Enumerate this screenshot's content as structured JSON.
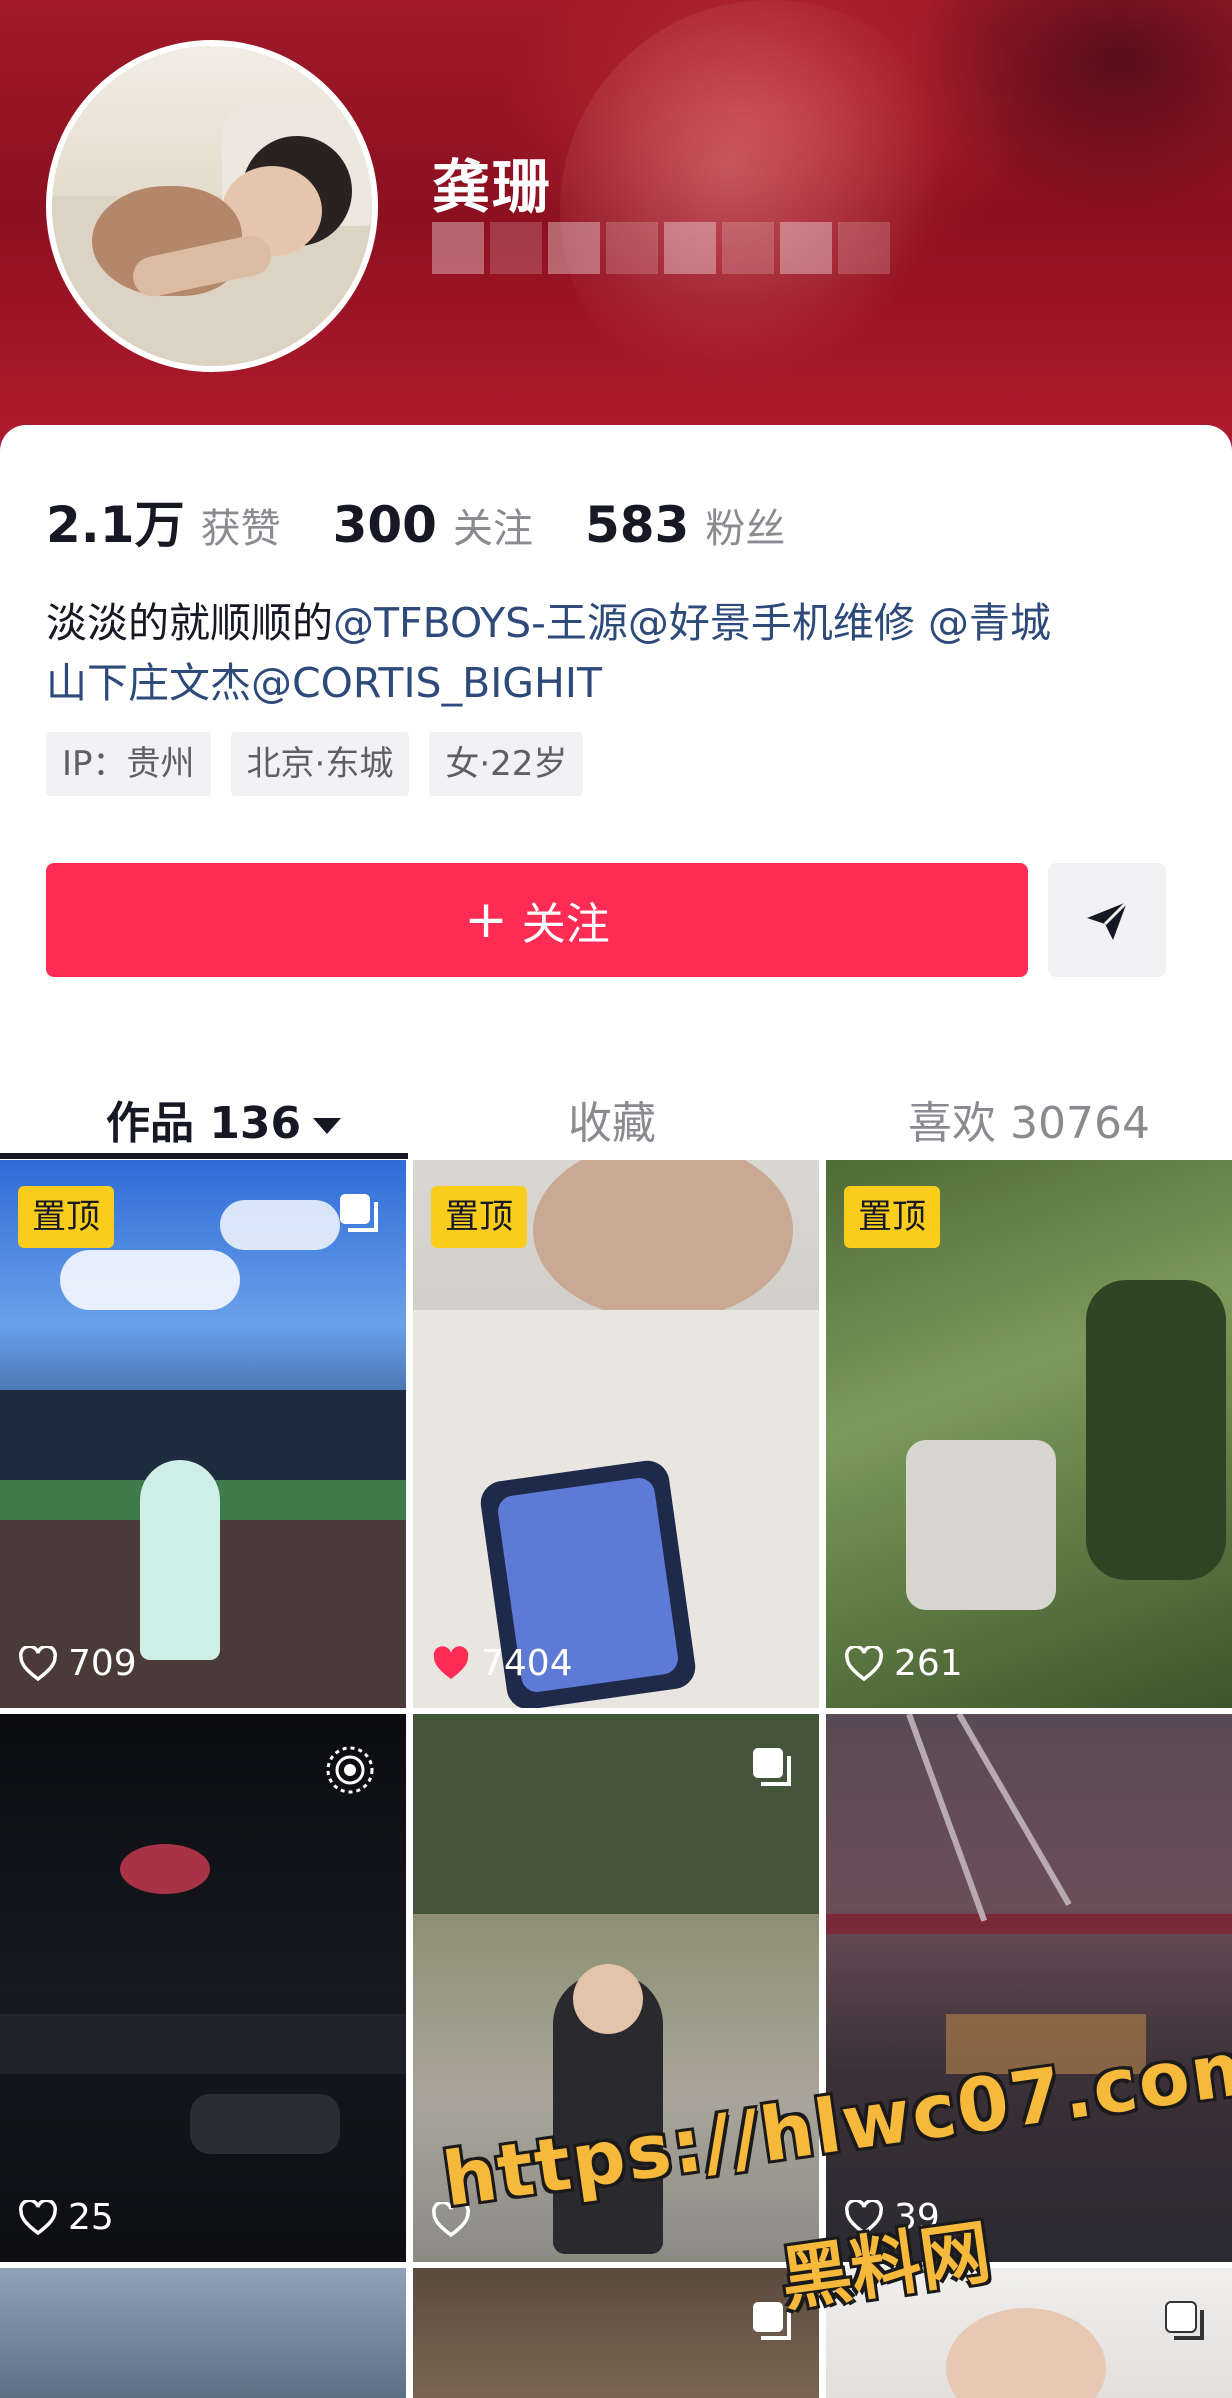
{
  "profile": {
    "nickname": "龚珊",
    "stats": [
      {
        "value": "2.1万",
        "label": "获赞"
      },
      {
        "value": "300",
        "label": "关注"
      },
      {
        "value": "583",
        "label": "粉丝"
      }
    ],
    "bio_plain": "淡淡的就顺顺的",
    "bio_mention_1": "@TFBOYS-王源@好景手机维修 @青城",
    "bio_mention_2": "山下庄文杰@CORTIS_BIGHIT",
    "tags": [
      "IP：贵州",
      "北京·东城",
      "女·22岁"
    ],
    "follow_label": "关注",
    "follow_plus": "+"
  },
  "tabs": [
    {
      "label": "作品 136",
      "active": true
    },
    {
      "label": "收藏",
      "active": false
    },
    {
      "label": "喜欢 30764",
      "active": false
    }
  ],
  "grid": [
    {
      "pinned": true,
      "pin_label": "置顶",
      "likes": "709",
      "multi": true
    },
    {
      "pinned": true,
      "pin_label": "置顶",
      "likes": "7404",
      "liked": true
    },
    {
      "pinned": true,
      "pin_label": "置顶",
      "likes": "261"
    },
    {
      "likes": "25",
      "live": true
    },
    {
      "likes": "",
      "multi": true
    },
    {
      "likes": "39"
    },
    {},
    {
      "multi": true
    },
    {
      "multi": true
    }
  ],
  "watermark": {
    "url": "https://hlwc07.com",
    "name": "黑料网"
  },
  "colors": {
    "accent": "#fe2c55",
    "pin_badge": "#facd1d",
    "mention": "#2e4a7a"
  },
  "icons": [
    "share-arrow-icon",
    "caret-down-icon",
    "heart-icon",
    "multi-image-icon",
    "live-icon"
  ]
}
